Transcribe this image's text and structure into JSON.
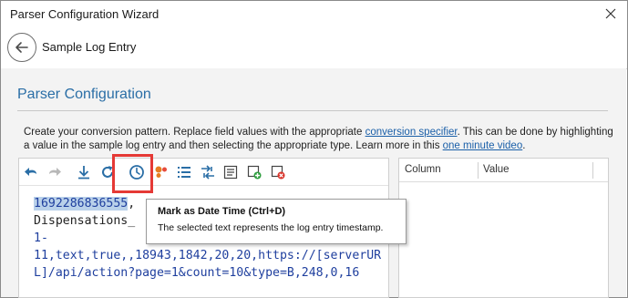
{
  "window": {
    "title": "Parser Configuration Wizard"
  },
  "nav": {
    "title": "Sample Log Entry"
  },
  "section": {
    "title": "Parser Configuration"
  },
  "description": {
    "text1": "Create your conversion pattern.  Replace field values with the appropriate ",
    "link1": "conversion specifier",
    "text2": ".  This can be done by highlighting a value in the sample log entry and then selecting the appropriate type.  Learn more in this ",
    "link2": "one minute video",
    "text3": "."
  },
  "toolbar": {
    "buttons": [
      {
        "name": "undo-icon",
        "interactable": true
      },
      {
        "name": "redo-icon",
        "interactable": true
      },
      {
        "name": "download-icon",
        "interactable": true
      },
      {
        "name": "refresh-icon",
        "interactable": true
      },
      {
        "name": "clock-icon",
        "interactable": true
      },
      {
        "name": "dots-icon",
        "interactable": true
      },
      {
        "name": "list-icon",
        "interactable": true
      },
      {
        "name": "split-icon",
        "interactable": true
      },
      {
        "name": "document-icon",
        "interactable": true
      },
      {
        "name": "add-field-icon",
        "interactable": true
      },
      {
        "name": "remove-field-icon",
        "interactable": true
      }
    ]
  },
  "log": {
    "line1_selected": "1692286836555",
    "line1_rest": ",",
    "line2": "Dispensations_",
    "line3": "1-",
    "line4": "11,text,true,,18943,1842,20,20,https://[serverUR",
    "line5a": "L]/api/action?page=1&count=10&type=B",
    "line5b": ",248,0,16"
  },
  "grid": {
    "col1": "Column",
    "col2": "Value"
  },
  "tooltip": {
    "title": "Mark as Date Time (Ctrl+D)",
    "body": "The selected text represents the log entry timestamp."
  },
  "colors": {
    "accent": "#2a6ea6",
    "highlight": "#e53935",
    "selection": "#b9d1ea"
  }
}
